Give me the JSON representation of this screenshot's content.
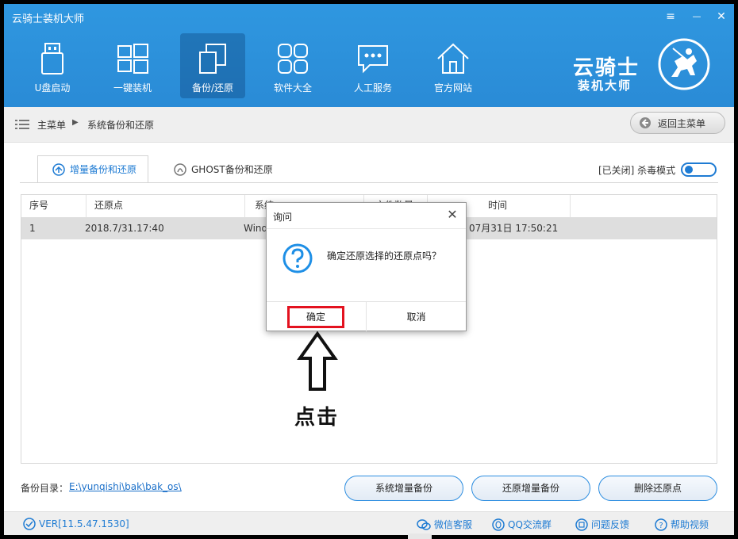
{
  "app": {
    "title": "云骑士装机大师"
  },
  "window_controls": {
    "menu": "≡",
    "minimize": "—",
    "close": "✕"
  },
  "nav": {
    "items": [
      {
        "label": "U盘启动",
        "icon": "usb-drive-icon"
      },
      {
        "label": "一键装机",
        "icon": "windows-icon"
      },
      {
        "label": "备份/还原",
        "icon": "backup-copy-icon",
        "active": true
      },
      {
        "label": "软件大全",
        "icon": "apps-grid-icon"
      },
      {
        "label": "人工服务",
        "icon": "chat-bubble-icon"
      },
      {
        "label": "官方网站",
        "icon": "home-icon"
      }
    ]
  },
  "brand": {
    "line1": "云骑士",
    "line2": "装机大师",
    "logo": "knight-logo-icon"
  },
  "breadcrumb": {
    "home": "主菜单",
    "current": "系统备份和还原",
    "back_label": "返回主菜单"
  },
  "tabs": [
    {
      "label": "增量备份和还原",
      "icon": "backup-icon",
      "active": true
    },
    {
      "label": "GHOST备份和还原",
      "icon": "ghost-icon",
      "active": false
    }
  ],
  "antivirus": {
    "label": "[已关闭] 杀毒模式",
    "state": "off"
  },
  "table": {
    "columns": [
      "序号",
      "还原点",
      "系统",
      "文件数量",
      "时间"
    ],
    "rows": [
      {
        "index": "1",
        "restore_point": "2018.7/31.17:40",
        "system": "Windo",
        "count": "",
        "time": "07月31日 17:50:21"
      }
    ]
  },
  "bottom": {
    "dir_label": "备份目录：",
    "dir_path": "E:\\yunqishi\\bak\\bak_os\\",
    "buttons": [
      "系统增量备份",
      "还原增量备份",
      "删除还原点"
    ]
  },
  "footer": {
    "version": "VER[11.5.47.1530]",
    "links": [
      {
        "label": "微信客服",
        "icon": "wechat-icon"
      },
      {
        "label": "QQ交流群",
        "icon": "qq-icon"
      },
      {
        "label": "问题反馈",
        "icon": "feedback-icon"
      },
      {
        "label": "帮助视频",
        "icon": "help-icon"
      }
    ]
  },
  "dialog": {
    "title": "询问",
    "close": "✕",
    "message": "确定还原选择的还原点吗？",
    "ok_label": "确定",
    "cancel_label": "取消",
    "icon": "question-icon"
  },
  "annotation": {
    "text": "点击",
    "arrow": "up-arrow-icon"
  },
  "colors": {
    "header_blue": "#2a8bd6",
    "accent": "#1e7bd3",
    "highlight_red": "#e3121f"
  }
}
